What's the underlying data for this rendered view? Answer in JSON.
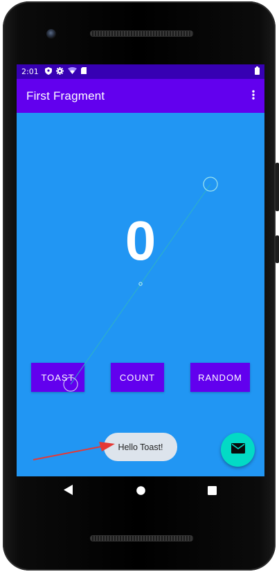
{
  "status_bar": {
    "time": "2:01",
    "icons": [
      "shield-icon",
      "gear-icon",
      "wifi-icon",
      "sim-card-icon",
      "battery-icon"
    ]
  },
  "app_bar": {
    "title": "First Fragment",
    "overflow_icon": "more-vert-icon"
  },
  "content": {
    "count_value": "0",
    "buttons": {
      "toast": "TOAST",
      "count": "COUNT",
      "random": "RANDOM"
    }
  },
  "toast": {
    "message": "Hello Toast!"
  },
  "fab": {
    "icon": "email-icon"
  },
  "nav_bar": {
    "icons": [
      "back-icon",
      "home-icon",
      "recents-icon"
    ]
  },
  "colors": {
    "status_bar": "#3700b3",
    "app_bar": "#6200ee",
    "background": "#2196f3",
    "button": "#6200ee",
    "fab": "#03dac5",
    "annotation_arrow": "#e53935"
  }
}
